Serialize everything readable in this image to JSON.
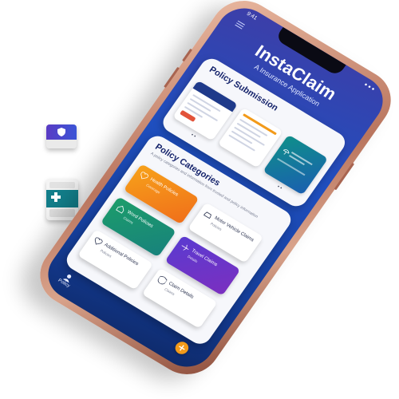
{
  "app": {
    "title": "InstaClaim",
    "subtitle": "A Insurance Application"
  },
  "status_bar": {
    "time": "9:41",
    "indicators": "● ● ●"
  },
  "policy_submission": {
    "title": "Policy Submission"
  },
  "policy_categories": {
    "title": "Policy Categories",
    "description": "A policy categories and information from trusted and policy information"
  },
  "tiles": [
    {
      "label": "Health Policies",
      "sub": "Coverage",
      "color": "#f7a21a"
    },
    {
      "label": "Motor Vehicle Claims",
      "sub": "Policies",
      "color": "#ffffff"
    },
    {
      "label": "Word Policies",
      "sub": "Claims",
      "color": "#1c9d6a"
    },
    {
      "label": "Travel Claims",
      "sub": "Details",
      "color": "#5a3bd0"
    },
    {
      "label": "Additional Policies",
      "sub": "Policies",
      "color": "#ffffff"
    },
    {
      "label": "Claim Details",
      "sub": "Claims",
      "color": "#ffffff"
    }
  ],
  "tab_bar": {
    "policy_label": "Policy"
  },
  "icons": [
    "menu-icon",
    "shield-icon",
    "medical-cross-icon",
    "umbrella-icon",
    "heart-icon",
    "car-icon",
    "home-icon",
    "plane-icon",
    "add-icon"
  ],
  "colors": {
    "screen_bg": "#1f4fbf",
    "accent_orange": "#f29a1a",
    "accent_teal": "#127e8a",
    "phone_frame": "#b9755e"
  }
}
